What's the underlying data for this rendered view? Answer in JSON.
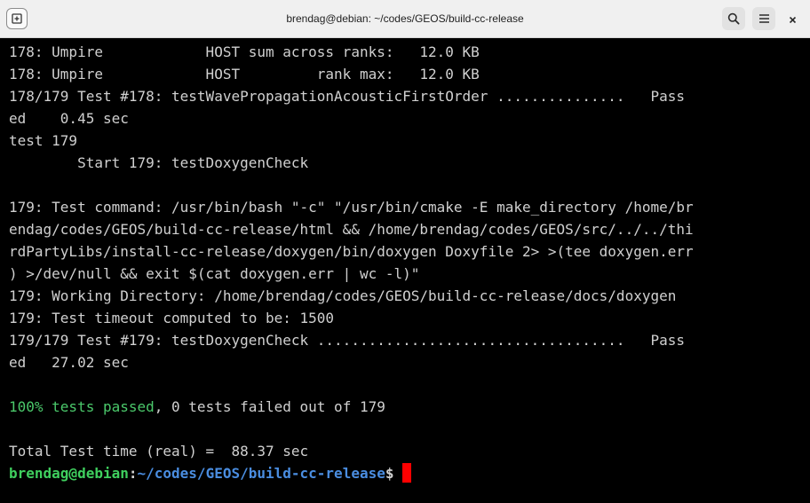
{
  "window": {
    "title": "brendag@debian: ~/codes/GEOS/build-cc-release",
    "icons": {
      "new_tab": "new-tab-icon",
      "search": "search-icon",
      "menu": "hamburger-menu-icon",
      "close": "close-icon"
    }
  },
  "terminal": {
    "lines": [
      "178: Umpire            HOST sum across ranks:   12.0 KB",
      "178: Umpire            HOST         rank max:   12.0 KB",
      "178/179 Test #178: testWavePropagationAcousticFirstOrder ...............   Pass",
      "ed    0.45 sec",
      "test 179",
      "        Start 179: testDoxygenCheck",
      "",
      "179: Test command: /usr/bin/bash \"-c\" \"/usr/bin/cmake -E make_directory /home/br",
      "endag/codes/GEOS/build-cc-release/html && /home/brendag/codes/GEOS/src/../../thi",
      "rdPartyLibs/install-cc-release/doxygen/bin/doxygen Doxyfile 2> >(tee doxygen.err",
      ") >/dev/null && exit $(cat doxygen.err | wc -l)\"",
      "179: Working Directory: /home/brendag/codes/GEOS/build-cc-release/docs/doxygen",
      "179: Test timeout computed to be: 1500",
      "179/179 Test #179: testDoxygenCheck ....................................   Pass",
      "ed   27.02 sec",
      ""
    ],
    "summary_passed": "100% tests passed",
    "summary_rest": ", 0 tests failed out of 179",
    "total_time": "Total Test time (real) =  88.37 sec",
    "prompt": {
      "user_host": "brendag@debian",
      "colon": ":",
      "path": "~/codes/GEOS/build-cc-release",
      "symbol": "$ "
    },
    "colors": {
      "background": "#000000",
      "text": "#d0d0d0",
      "passed": "#4bc96b",
      "prompt_user": "#3fcf5e",
      "prompt_path": "#4a8de0",
      "cursor": "#ff0000"
    }
  }
}
